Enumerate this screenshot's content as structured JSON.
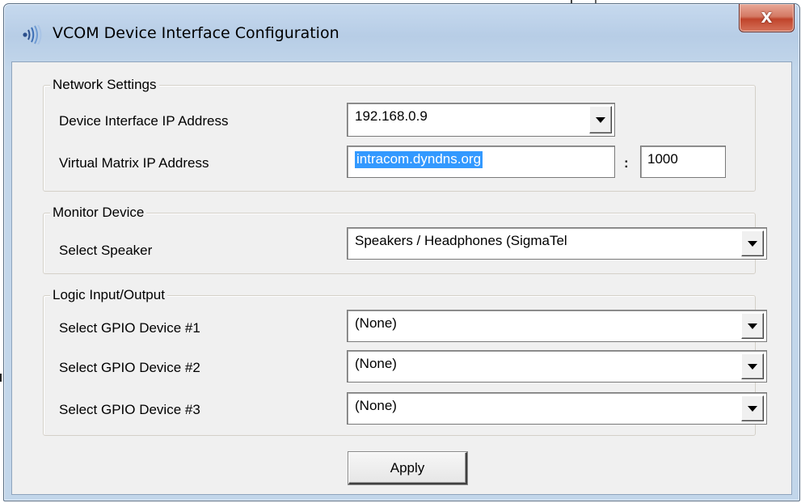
{
  "window": {
    "title": "VCOM Device Interface Configuration",
    "close_glyph": "X"
  },
  "network": {
    "legend": "Network Settings",
    "device_ip_label": "Device Interface IP Address",
    "device_ip_value": "192.168.0.9",
    "matrix_ip_label": "Virtual Matrix IP Address",
    "matrix_host_value": "intracom.dyndns.org",
    "port_separator": ":",
    "matrix_port_value": "1000"
  },
  "monitor": {
    "legend": "Monitor Device",
    "speaker_label": "Select Speaker",
    "speaker_value": "Speakers / Headphones (SigmaTel"
  },
  "logic": {
    "legend": "Logic Input/Output",
    "gpio": [
      {
        "label": "Select GPIO Device #1",
        "value": "(None)"
      },
      {
        "label": "Select GPIO Device #2",
        "value": "(None)"
      },
      {
        "label": "Select GPIO Device #3",
        "value": "(None)"
      }
    ]
  },
  "apply_label": "Apply",
  "colors": {
    "selection": "#3399ff",
    "close_button": "#c0442b",
    "dialog_face": "#f0f0f0"
  },
  "icons": {
    "title": "signal-waves-icon",
    "dropdown": "chevron-down-icon"
  }
}
